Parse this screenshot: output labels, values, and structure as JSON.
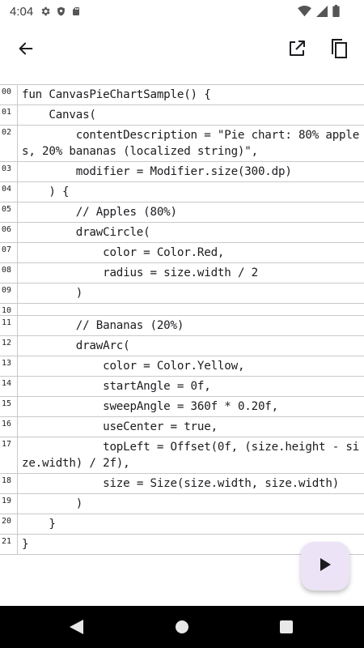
{
  "status_bar": {
    "time": "4:04",
    "left_icons": [
      "gear-icon",
      "shield-icon",
      "sd-card-icon"
    ],
    "right_icons": [
      "wifi-icon",
      "signal-icon",
      "battery-icon"
    ]
  },
  "app_bar": {
    "back_icon": "arrow-back-icon",
    "actions": [
      "open-in-new-icon",
      "copy-icon"
    ]
  },
  "code": {
    "lines": [
      {
        "num": "00",
        "text": "fun CanvasPieChartSample() {"
      },
      {
        "num": "01",
        "text": "    Canvas("
      },
      {
        "num": "02",
        "text": "        contentDescription = \"Pie chart: 80% apples, 20% bananas (localized string)\","
      },
      {
        "num": "03",
        "text": "        modifier = Modifier.size(300.dp)"
      },
      {
        "num": "04",
        "text": "    ) {"
      },
      {
        "num": "05",
        "text": "        // Apples (80%)"
      },
      {
        "num": "06",
        "text": "        drawCircle("
      },
      {
        "num": "07",
        "text": "            color = Color.Red,"
      },
      {
        "num": "08",
        "text": "            radius = size.width / 2"
      },
      {
        "num": "09",
        "text": "        )"
      },
      {
        "num": "10",
        "text": ""
      },
      {
        "num": "11",
        "text": "        // Bananas (20%)"
      },
      {
        "num": "12",
        "text": "        drawArc("
      },
      {
        "num": "13",
        "text": "            color = Color.Yellow,"
      },
      {
        "num": "14",
        "text": "            startAngle = 0f,"
      },
      {
        "num": "15",
        "text": "            sweepAngle = 360f * 0.20f,"
      },
      {
        "num": "16",
        "text": "            useCenter = true,"
      },
      {
        "num": "17",
        "text": "            topLeft = Offset(0f, (size.height - size.width) / 2f),"
      },
      {
        "num": "18",
        "text": "            size = Size(size.width, size.width)"
      },
      {
        "num": "19",
        "text": "        )"
      },
      {
        "num": "20",
        "text": "    }"
      },
      {
        "num": "21",
        "text": "}"
      }
    ]
  },
  "fab": {
    "icon": "play-icon"
  },
  "nav_bar": {
    "buttons": [
      "nav-back-icon",
      "nav-home-icon",
      "nav-recents-icon"
    ]
  }
}
